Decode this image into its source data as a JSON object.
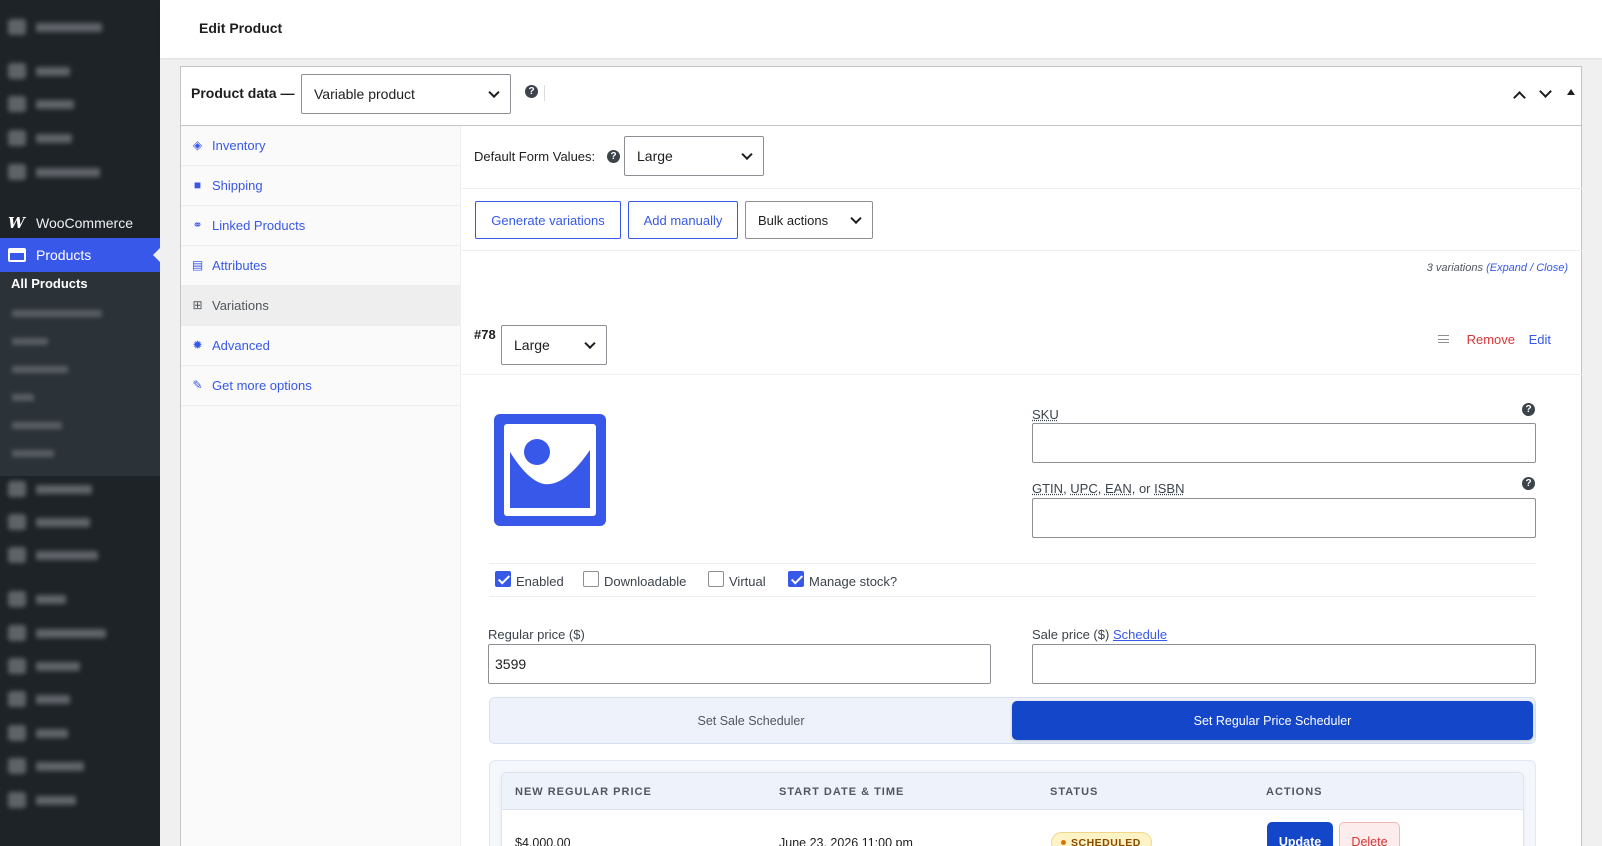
{
  "header": {
    "title": "Edit Product"
  },
  "sidebar": {
    "woocommerce_label": "WooCommerce",
    "products_label": "Products",
    "all_products_label": "All Products"
  },
  "product_data": {
    "label": "Product data —",
    "type_selected": "Variable product"
  },
  "tabs": [
    {
      "label": "Inventory",
      "icon": "tag-icon"
    },
    {
      "label": "Shipping",
      "icon": "truck-icon"
    },
    {
      "label": "Linked Products",
      "icon": "link-icon"
    },
    {
      "label": "Attributes",
      "icon": "list-icon"
    },
    {
      "label": "Variations",
      "icon": "grid-icon"
    },
    {
      "label": "Advanced",
      "icon": "gear-icon"
    },
    {
      "label": "Get more options",
      "icon": "plugin-icon"
    }
  ],
  "defaults": {
    "label": "Default Form Values:",
    "selected": "Large"
  },
  "actions": {
    "generate": "Generate variations",
    "add_manually": "Add manually",
    "bulk": "Bulk actions",
    "count_text": "3 variations",
    "expand_close": "(Expand / Close)"
  },
  "variation": {
    "id": "#78",
    "size_selected": "Large",
    "remove": "Remove",
    "edit": "Edit",
    "sku_label": "SKU",
    "sku_value": "",
    "gtin_label_parts": [
      "GTIN",
      "UPC",
      "EAN",
      "ISBN"
    ],
    "gtin_value": "",
    "checkboxes": [
      {
        "label": "Enabled",
        "checked": true
      },
      {
        "label": "Downloadable",
        "checked": false
      },
      {
        "label": "Virtual",
        "checked": false
      },
      {
        "label": "Manage stock?",
        "checked": true
      }
    ],
    "regular_price_label": "Regular price ($)",
    "regular_price_value": "3599",
    "sale_price_label": "Sale price ($)",
    "schedule_link": "Schedule",
    "sale_price_value": ""
  },
  "scheduler": {
    "sale_tab": "Set Sale Scheduler",
    "regular_tab": "Set Regular Price Scheduler",
    "columns": [
      "NEW REGULAR PRICE",
      "START DATE & TIME",
      "STATUS",
      "ACTIONS"
    ],
    "row": {
      "price": "$4,000.00",
      "start": "June 23, 2026 11:00 pm",
      "status": "SCHEDULED",
      "update": "Update",
      "delete": "Delete"
    }
  },
  "colors": {
    "accent": "#3858e9",
    "scheduler_active": "#1346c8",
    "danger": "#d63638"
  }
}
